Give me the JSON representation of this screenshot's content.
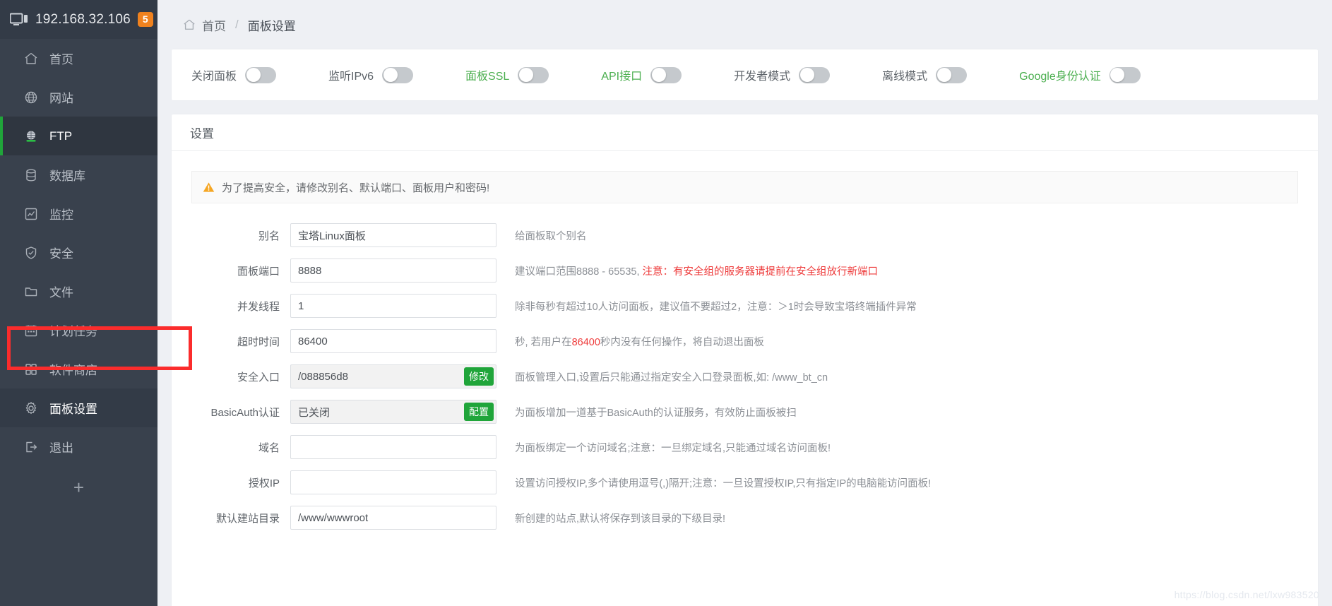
{
  "sidebar": {
    "host": "192.168.32.106",
    "badge": "5",
    "items": [
      {
        "label": "首页",
        "icon": "home-icon",
        "state": "normal"
      },
      {
        "label": "网站",
        "icon": "globe-icon",
        "state": "normal"
      },
      {
        "label": "FTP",
        "icon": "ftp-globe-icon",
        "state": "active"
      },
      {
        "label": "数据库",
        "icon": "database-icon",
        "state": "normal"
      },
      {
        "label": "监控",
        "icon": "monitor-chart-icon",
        "state": "normal"
      },
      {
        "label": "安全",
        "icon": "shield-check-icon",
        "state": "normal"
      },
      {
        "label": "文件",
        "icon": "folder-icon",
        "state": "normal"
      },
      {
        "label": "计划任务",
        "icon": "calendar-icon",
        "state": "normal"
      },
      {
        "label": "软件商店",
        "icon": "grid-apps-icon",
        "state": "normal"
      },
      {
        "label": "面板设置",
        "icon": "gear-icon",
        "state": "current"
      },
      {
        "label": "退出",
        "icon": "logout-icon",
        "state": "normal"
      }
    ],
    "add_label": "+"
  },
  "breadcrumb": {
    "home": "首页",
    "separator": "/",
    "current": "面板设置"
  },
  "toggles": [
    {
      "label": "关闭面板",
      "green": false,
      "on": false
    },
    {
      "label": "监听IPv6",
      "green": false,
      "on": false
    },
    {
      "label": "面板SSL",
      "green": true,
      "on": false
    },
    {
      "label": "API接口",
      "green": true,
      "on": false
    },
    {
      "label": "开发者模式",
      "green": false,
      "on": false
    },
    {
      "label": "离线模式",
      "green": false,
      "on": false
    },
    {
      "label": "Google身份认证",
      "green": true,
      "on": false
    }
  ],
  "panel": {
    "title": "设置",
    "notice": "为了提高安全，请修改别名、默认端口、面板用户和密码!",
    "rows": [
      {
        "label": "别名",
        "value": "宝塔Linux面板",
        "placeholder": "",
        "readonly": false,
        "button": null,
        "hint_pre": "给面板取个别名",
        "hint_red": "",
        "hint_post": ""
      },
      {
        "label": "面板端口",
        "value": "8888",
        "placeholder": "",
        "readonly": false,
        "button": null,
        "hint_pre": "建议端口范围8888 - 65535, ",
        "hint_red": "注意：有安全组的服务器请提前在安全组放行新端口",
        "hint_post": ""
      },
      {
        "label": "并发线程",
        "value": "1",
        "placeholder": "",
        "readonly": false,
        "button": null,
        "hint_pre": "除非每秒有超过10人访问面板，建议值不要超过2，注意：＞1时会导致宝塔终端插件异常",
        "hint_red": "",
        "hint_post": ""
      },
      {
        "label": "超时时间",
        "value": "86400",
        "placeholder": "",
        "readonly": false,
        "button": null,
        "hint_pre": "秒, 若用户在",
        "hint_red": "86400",
        "hint_post": "秒内没有任何操作，将自动退出面板"
      },
      {
        "label": "安全入口",
        "value": "/088856d8",
        "placeholder": "",
        "readonly": true,
        "button": "修改",
        "hint_pre": "面板管理入口,设置后只能通过指定安全入口登录面板,如: /www_bt_cn",
        "hint_red": "",
        "hint_post": ""
      },
      {
        "label": "BasicAuth认证",
        "value": "已关闭",
        "placeholder": "",
        "readonly": true,
        "button": "配置",
        "hint_pre": "为面板增加一道基于BasicAuth的认证服务，有效防止面板被扫",
        "hint_red": "",
        "hint_post": ""
      },
      {
        "label": "域名",
        "value": "",
        "placeholder": "",
        "readonly": false,
        "button": null,
        "hint_pre": "为面板绑定一个访问域名;注意：一旦绑定域名,只能通过域名访问面板!",
        "hint_red": "",
        "hint_post": ""
      },
      {
        "label": "授权IP",
        "value": "",
        "placeholder": "",
        "readonly": false,
        "button": null,
        "hint_pre": "设置访问授权IP,多个请使用逗号(,)隔开;注意：一旦设置授权IP,只有指定IP的电脑能访问面板!",
        "hint_red": "",
        "hint_post": ""
      },
      {
        "label": "默认建站目录",
        "value": "/www/wwwroot",
        "placeholder": "",
        "readonly": false,
        "button": null,
        "hint_pre": "新创建的站点,默认将保存到该目录的下级目录!",
        "hint_red": "",
        "hint_post": ""
      }
    ]
  },
  "watermark": "https://blog.csdn.net/lxw983520",
  "colors": {
    "sidebar_bg": "#39414d",
    "sidebar_head": "#333b47",
    "accent_green": "#20a53a",
    "badge_orange": "#f0821e",
    "highlight_red": "#fb2c2c",
    "hint_red": "#ee3a3a"
  }
}
